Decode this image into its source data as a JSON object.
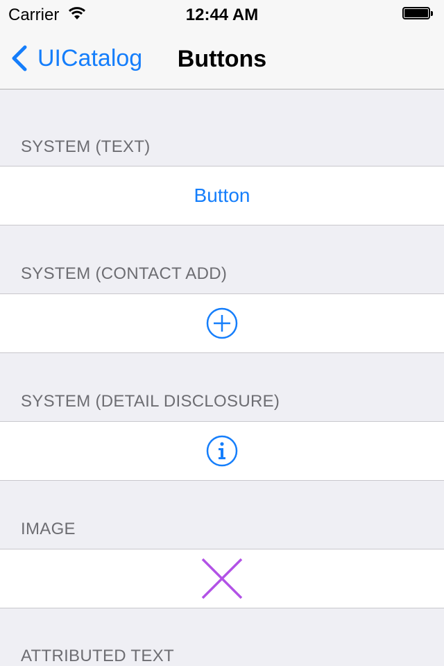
{
  "status_bar": {
    "carrier": "Carrier",
    "time": "12:44 AM",
    "battery_level": 1.0
  },
  "nav": {
    "back_label": "UICatalog",
    "title": "Buttons"
  },
  "sections": [
    {
      "header": "SYSTEM (TEXT)",
      "button_label": "Button"
    },
    {
      "header": "SYSTEM (CONTACT ADD)",
      "icon": "contact-add-icon"
    },
    {
      "header": "SYSTEM (DETAIL DISCLOSURE)",
      "icon": "info-icon"
    },
    {
      "header": "IMAGE",
      "icon": "x-image-icon"
    },
    {
      "header": "ATTRIBUTED TEXT"
    }
  ],
  "colors": {
    "tint": "#157efb",
    "image_button": "#b252e6",
    "background": "#efeff4",
    "section_header_text": "#6d6d72"
  }
}
